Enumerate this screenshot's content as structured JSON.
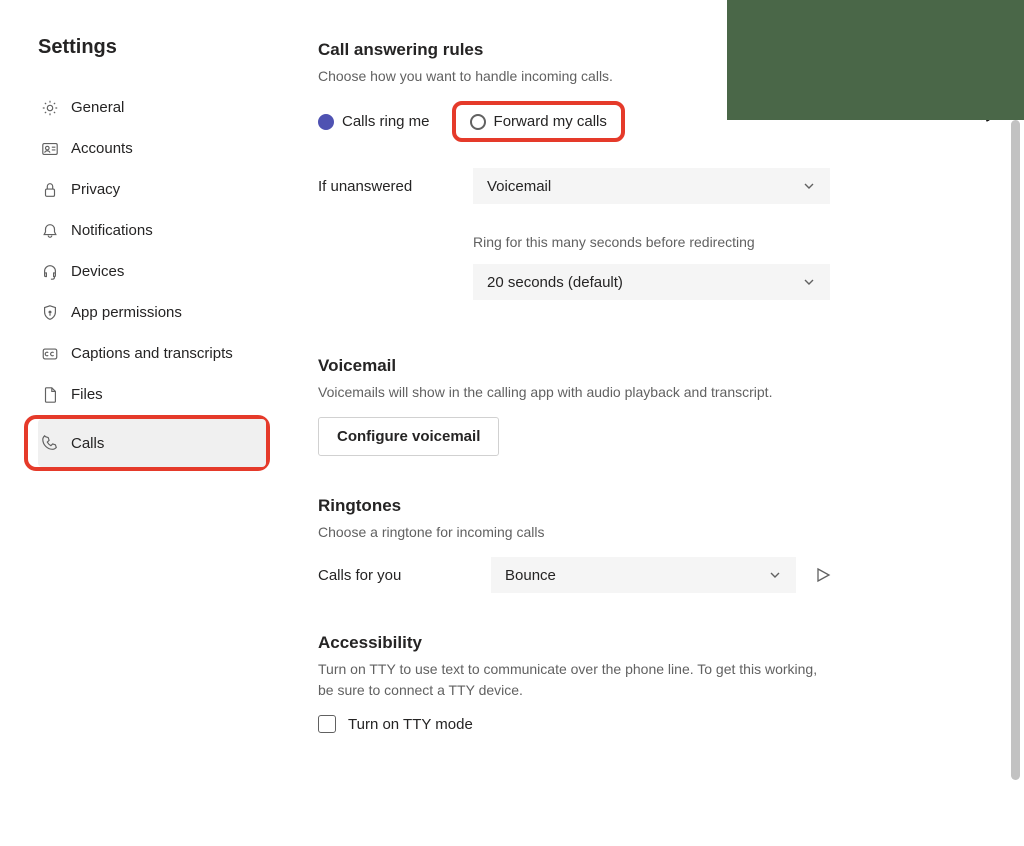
{
  "title": "Settings",
  "sidebar": {
    "items": [
      {
        "label": "General",
        "icon": "gear-icon"
      },
      {
        "label": "Accounts",
        "icon": "id-card-icon"
      },
      {
        "label": "Privacy",
        "icon": "lock-icon"
      },
      {
        "label": "Notifications",
        "icon": "bell-icon"
      },
      {
        "label": "Devices",
        "icon": "headset-icon"
      },
      {
        "label": "App permissions",
        "icon": "shield-icon"
      },
      {
        "label": "Captions and transcripts",
        "icon": "cc-icon"
      },
      {
        "label": "Files",
        "icon": "file-icon"
      },
      {
        "label": "Calls",
        "icon": "phone-icon"
      }
    ]
  },
  "call_rules": {
    "heading": "Call answering rules",
    "subtext": "Choose how you want to handle incoming calls.",
    "radio_ring": "Calls ring me",
    "radio_forward": "Forward my calls",
    "if_unanswered_label": "If unanswered",
    "if_unanswered_value": "Voicemail",
    "ring_duration_label": "Ring for this many seconds before redirecting",
    "ring_duration_value": "20 seconds (default)"
  },
  "voicemail": {
    "heading": "Voicemail",
    "subtext": "Voicemails will show in the calling app with audio playback and transcript.",
    "button": "Configure voicemail"
  },
  "ringtones": {
    "heading": "Ringtones",
    "subtext": "Choose a ringtone for incoming calls",
    "label": "Calls for you",
    "value": "Bounce"
  },
  "accessibility": {
    "heading": "Accessibility",
    "subtext": "Turn on TTY to use text to communicate over the phone line. To get this working, be sure to connect a TTY device.",
    "checkbox_label": "Turn on TTY mode"
  }
}
